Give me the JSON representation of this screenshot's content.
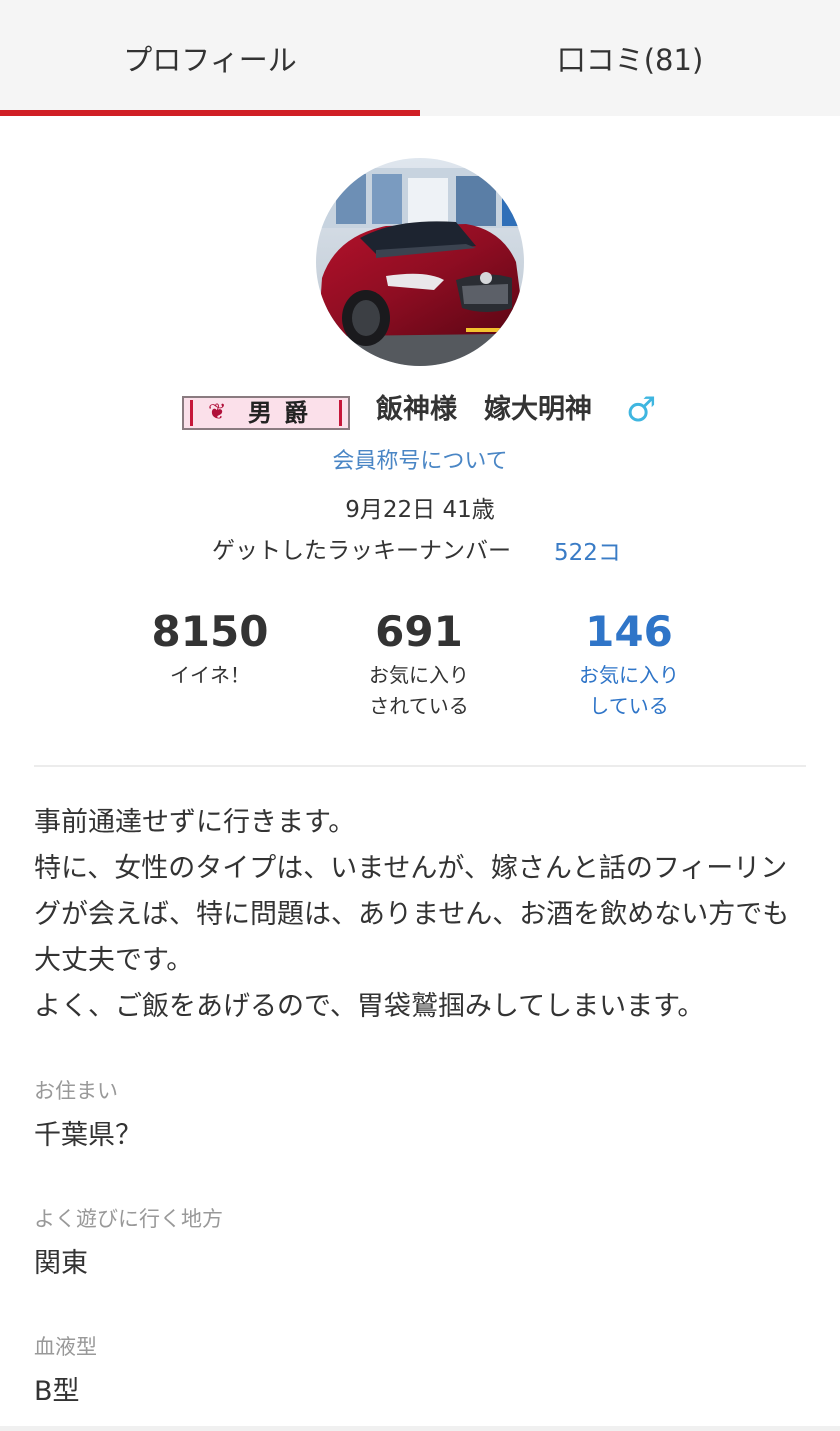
{
  "tabs": [
    {
      "label": "プロフィール",
      "active": true
    },
    {
      "label": "口コミ(81)",
      "active": false
    }
  ],
  "profile": {
    "avatar_description": "red car profile photo",
    "rank": {
      "crest": "❦",
      "text": "男爵"
    },
    "nickname": "飯神様　嫁大明神",
    "gender_icon": "male-icon",
    "gender_symbol": "♂",
    "member_title_link": "会員称号について",
    "birthday_age": "9月22日 41歳",
    "lucky_number_label": "ゲットしたラッキーナンバー",
    "lucky_number_count": "522コ"
  },
  "stats": [
    {
      "value": "8150",
      "label": "イイネ！"
    },
    {
      "value": "691",
      "label": "お気に入り\nされている"
    },
    {
      "value": "146",
      "label": "お気に入り\nしている"
    }
  ],
  "intro": [
    "事前通達せずに行きます。",
    "特に、女性のタイプは、いませんが、嫁さんと話のフィーリングが会えば、特に問題は、ありません、お酒を飲めない方でも大丈夫です。",
    "よく、ご飯をあげるので、胃袋鷲掴みしてしまいます。"
  ],
  "fields": [
    {
      "label": "お住まい",
      "value": "千葉県？"
    },
    {
      "label": "よく遊びに行く地方",
      "value": "関東"
    },
    {
      "label": "血液型",
      "value": "B型"
    }
  ],
  "colors": {
    "accent_red": "#d01f26",
    "link_blue": "#3a7cc6",
    "gender_blue": "#3fb6e0"
  }
}
